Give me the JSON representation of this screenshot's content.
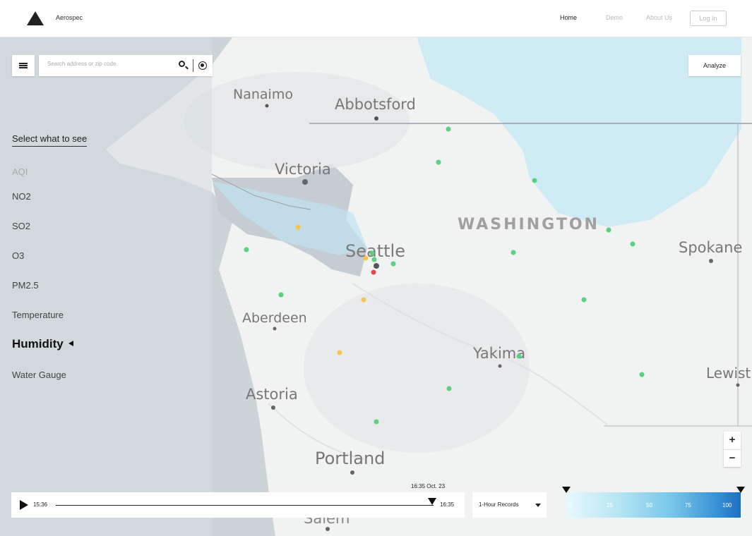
{
  "header": {
    "brand": "Aerospec",
    "nav": {
      "home": "Home",
      "demo": "Demo",
      "about": "About Us",
      "login": "Log In"
    }
  },
  "search": {
    "placeholder": "Search address or zip code",
    "value": ""
  },
  "analyze_label": "Analyze",
  "layers": {
    "title": "Select what to see",
    "items": [
      {
        "label": "AQI",
        "state": "disabled"
      },
      {
        "label": "NO2",
        "state": "normal"
      },
      {
        "label": "SO2",
        "state": "normal"
      },
      {
        "label": "O3",
        "state": "normal"
      },
      {
        "label": "PM2.5",
        "state": "normal"
      },
      {
        "label": "Temperature",
        "state": "normal"
      },
      {
        "label": "Humidity",
        "state": "active"
      },
      {
        "label": "Water Gauge",
        "state": "normal"
      }
    ]
  },
  "map": {
    "state_label": "WASHINGTON",
    "cities": [
      "Nanaimo",
      "Abbotsford",
      "Victoria",
      "Seattle",
      "Spokane",
      "Aberdeen",
      "Yakima",
      "Lewist",
      "Astoria",
      "Portland",
      "Salem"
    ],
    "sensor_colors": {
      "good": "#5bd17f",
      "moderate": "#f6c64b",
      "poor": "#e24a4a",
      "selected": "#555555"
    }
  },
  "timeline": {
    "start_time": "15:36",
    "end_time": "16:35",
    "current": "16:35 Oct. 23",
    "progress": 0.98
  },
  "records_select": "1-Hour Records",
  "legend": {
    "ticks": [
      "0",
      "25",
      "50",
      "75",
      "100"
    ]
  },
  "zoom": {
    "in": "+",
    "out": "−"
  }
}
